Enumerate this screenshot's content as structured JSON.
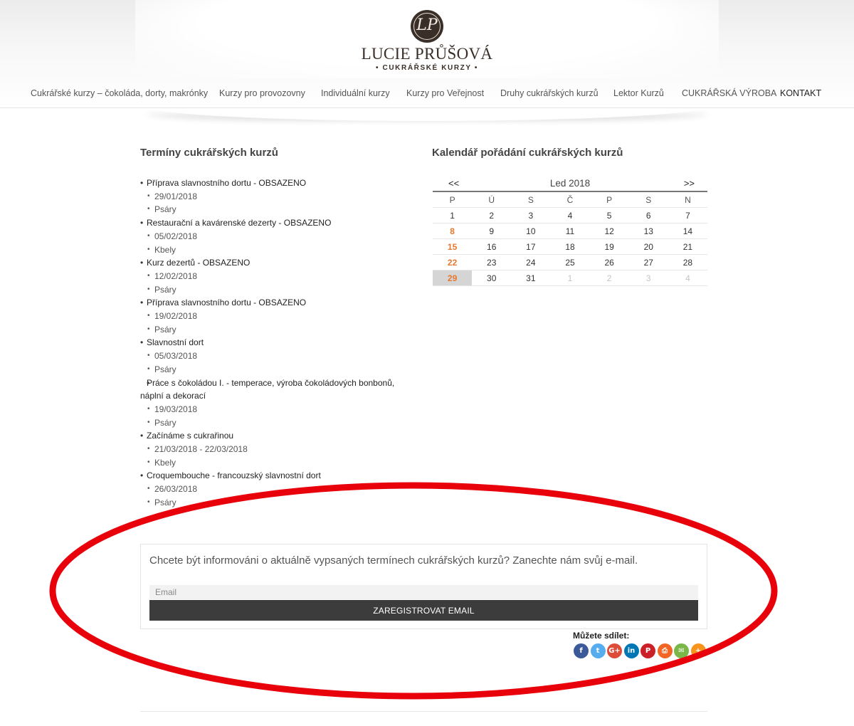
{
  "brand": {
    "monogram": "LP",
    "name": "LUCIE PRŮŠOVÁ",
    "tagline": "• CUKRÁŘSKÉ KURZY •"
  },
  "nav": [
    {
      "label": "Cukrářské kurzy – čokoláda, dorty, makrónky",
      "active": false
    },
    {
      "label": "Kurzy pro provozovny",
      "active": false
    },
    {
      "label": "Individuální kurzy",
      "active": false
    },
    {
      "label": "Kurzy pro Veřejnost",
      "active": false
    },
    {
      "label": "Druhy cukrářských kurzů",
      "active": false
    },
    {
      "label": "Lektor Kurzů",
      "active": false
    },
    {
      "label": "CUKRÁŘSKÁ VÝROBA",
      "active": false
    },
    {
      "label": "KONTAKT",
      "active": true
    }
  ],
  "events_section": {
    "title": "Termíny cukrářských kurzů",
    "events": [
      {
        "title": "Příprava slavnostního dortu - OBSAZENO",
        "date": "29/01/2018",
        "place": "Psáry"
      },
      {
        "title": "Restaurační a kavárenské dezerty - OBSAZENO",
        "date": "05/02/2018",
        "place": "Kbely"
      },
      {
        "title": "Kurz dezertů - OBSAZENO",
        "date": "12/02/2018",
        "place": "Psáry"
      },
      {
        "title": "Příprava slavnostního dortu - OBSAZENO",
        "date": "19/02/2018",
        "place": "Psáry"
      },
      {
        "title": "Slavnostní dort",
        "date": "05/03/2018",
        "place": "Psáry"
      },
      {
        "title": "Práce s čokoládou I. - temperace, výroba čokoládových bonbonů, náplní a dekorací",
        "date": "19/03/2018",
        "place": "Psáry"
      },
      {
        "title": "Začínáme s cukrařinou",
        "date": "21/03/2018 - 22/03/2018",
        "place": "Kbely"
      },
      {
        "title": "Croquembouche - francouzský slavnostní dort",
        "date": "26/03/2018",
        "place": "Psáry"
      }
    ]
  },
  "calendar": {
    "title": "Kalendář pořádání cukrářských kurzů",
    "prev": "<<",
    "next": ">>",
    "month": "Led 2018",
    "weekdays": [
      "P",
      "Ú",
      "S",
      "Č",
      "P",
      "S",
      "N"
    ],
    "weeks": [
      [
        "1",
        "2",
        "3",
        "4",
        "5",
        "6",
        "7"
      ],
      [
        "8",
        "9",
        "10",
        "11",
        "12",
        "13",
        "14"
      ],
      [
        "15",
        "16",
        "17",
        "18",
        "19",
        "20",
        "21"
      ],
      [
        "22",
        "23",
        "24",
        "25",
        "26",
        "27",
        "28"
      ],
      [
        "29",
        "30",
        "31",
        "1",
        "2",
        "3",
        "4"
      ]
    ],
    "event_days": [
      "8",
      "15",
      "22",
      "29"
    ],
    "today": "29",
    "next_month_days_in_last_week": 4
  },
  "signup": {
    "text": "Chcete být informováni o aktuálně vypsaných termínech cukrářských kurzů? Zanechte nám svůj e-mail.",
    "email_placeholder": "Email",
    "button_label": "ZAREGISTROVAT EMAIL"
  },
  "share": {
    "label": "Můžete sdílet:",
    "icons": [
      {
        "name": "facebook-icon",
        "glyph": "f",
        "color": "#3b5998"
      },
      {
        "name": "twitter-icon",
        "glyph": "t",
        "color": "#55acee"
      },
      {
        "name": "google-plus-icon",
        "glyph": "G+",
        "color": "#dd4b39"
      },
      {
        "name": "linkedin-icon",
        "glyph": "in",
        "color": "#0077b5"
      },
      {
        "name": "pinterest-icon",
        "glyph": "P",
        "color": "#cb2027"
      },
      {
        "name": "print-icon",
        "glyph": "⎙",
        "color": "#f26522"
      },
      {
        "name": "email-icon",
        "glyph": "✉",
        "color": "#7ab648"
      },
      {
        "name": "more-share-icon",
        "glyph": "+",
        "color": "#f7941d"
      }
    ]
  },
  "annotation": {
    "color": "#e8000b"
  }
}
